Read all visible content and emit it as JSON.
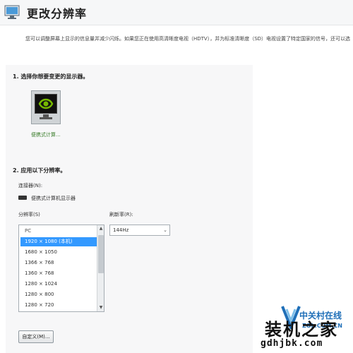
{
  "header": {
    "title": "更改分辨率",
    "icon": "display-settings-icon"
  },
  "description": "您可以调整屏幕上显示的信息量并减少闪烁。如果您正在使用高清晰度电视（HDTV），并为标准清晰度（SD）电视设置了特定国家的信号，还可以选择高清晰（HD）制式。",
  "section1": {
    "title": "1. 选择你想要变更的显示器。",
    "monitor_label": "便携式计算...",
    "monitor_icon": "monitor-icon"
  },
  "section2": {
    "title": "2. 应用以下分辨率。",
    "connector_label": "连接器(N):",
    "connector_value": "便携式计算机显示器",
    "resolution_label": "分辨率(S)",
    "refresh_label": "刷新率(R):",
    "refresh_value": "144Hz",
    "resolutions": [
      {
        "label": "PC",
        "group": true
      },
      {
        "label": "1920 × 1080 (本机)",
        "selected": true
      },
      {
        "label": "1680 × 1050"
      },
      {
        "label": "1366 × 768"
      },
      {
        "label": "1360 × 768"
      },
      {
        "label": "1280 × 1024"
      },
      {
        "label": "1280 × 800"
      },
      {
        "label": "1280 × 720"
      }
    ],
    "custom_button": "自定义(M)..."
  },
  "watermark": {
    "brand": "中关村在线",
    "domain1": "ZOL.COM.CN",
    "main": "装机之家",
    "domain2": "gdhjbk.com"
  },
  "colors": {
    "selection": "#3399ff",
    "brand_blue": "#1f6fb8",
    "nvidia_green": "#76b900"
  }
}
